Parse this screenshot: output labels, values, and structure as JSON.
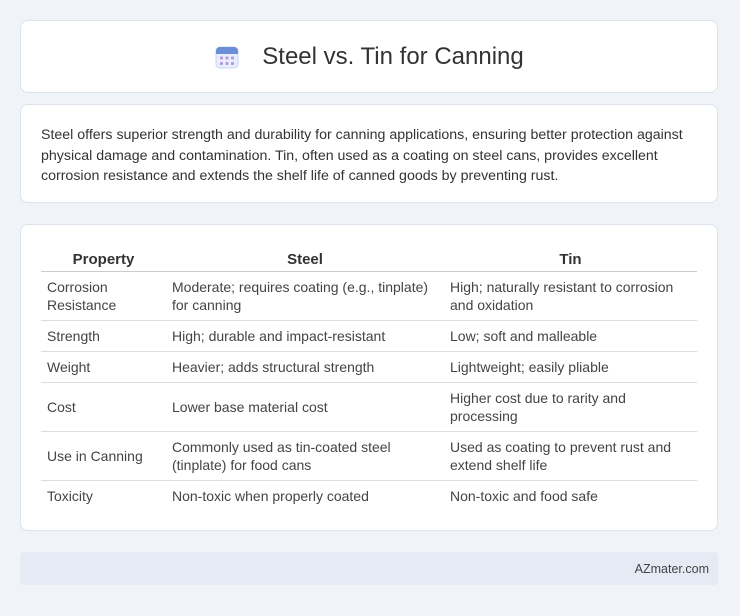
{
  "header": {
    "title": "Steel vs. Tin for Canning",
    "icon": "calendar-icon"
  },
  "summary": {
    "text": "Steel offers superior strength and durability for canning applications, ensuring better protection against physical damage and contamination. Tin, often used as a coating on steel cans, provides excellent corrosion resistance and extends the shelf life of canned goods by preventing rust."
  },
  "table": {
    "headers": [
      "Property",
      "Steel",
      "Tin"
    ],
    "rows": [
      [
        "Corrosion Resistance",
        "Moderate; requires coating (e.g., tinplate) for canning",
        "High; naturally resistant to corrosion and oxidation"
      ],
      [
        "Strength",
        "High; durable and impact-resistant",
        "Low; soft and malleable"
      ],
      [
        "Weight",
        "Heavier; adds structural strength",
        "Lightweight; easily pliable"
      ],
      [
        "Cost",
        "Lower base material cost",
        "Higher cost due to rarity and processing"
      ],
      [
        "Use in Canning",
        "Commonly used as tin-coated steel (tinplate) for food cans",
        "Used as coating to prevent rust and extend shelf life"
      ],
      [
        "Toxicity",
        "Non-toxic when properly coated",
        "Non-toxic and food safe"
      ]
    ]
  },
  "footer": {
    "text": "AZmater.com"
  },
  "colors": {
    "background": "#f0f4f9",
    "card": "#ffffff",
    "footer_bg": "#e4ebf5",
    "icon_accent": "#6b8fd6"
  }
}
